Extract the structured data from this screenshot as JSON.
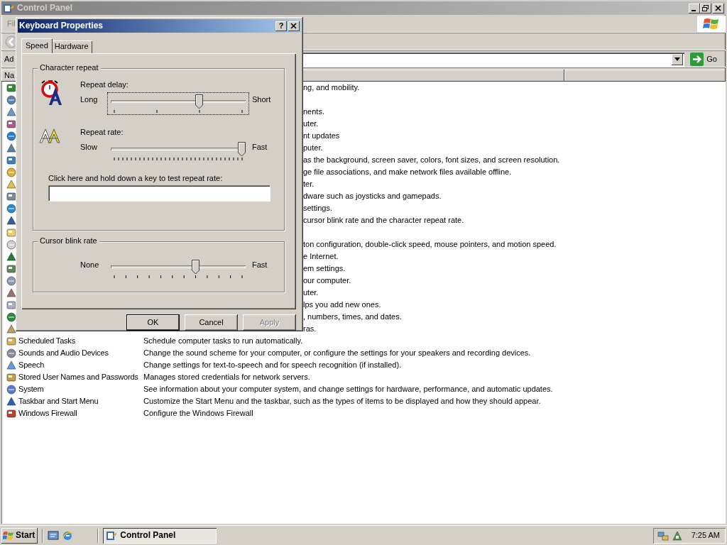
{
  "window": {
    "title": "Control Panel",
    "menu_item": "Fil",
    "address_label": "Ad",
    "go_button": "Go",
    "column_header": "Na"
  },
  "list": {
    "rows": [
      {
        "description": "ng, and mobility."
      },
      {},
      {
        "description": "nents."
      },
      {
        "description": "uter."
      },
      {
        "description": "nt updates"
      },
      {
        "description": "puter."
      },
      {
        "description": "as the background, screen saver, colors, font sizes, and screen resolution."
      },
      {
        "description": "ge file associations, and make network files available offline."
      },
      {
        "description": "ter."
      },
      {
        "description": "dware such as joysticks and gamepads."
      },
      {
        "description": "settings."
      },
      {
        "description": "cursor blink rate and the character repeat rate."
      },
      {},
      {
        "description": "ton configuration, double-click speed, mouse pointers, and motion speed."
      },
      {
        "description": "e Internet."
      },
      {
        "description": "em settings."
      },
      {
        "description": "our computer."
      },
      {
        "description": "uter."
      },
      {
        "description": "lps you add new ones."
      },
      {
        "description": ", numbers, times, and dates."
      },
      {
        "description": "ras."
      },
      {
        "name": "Scheduled Tasks",
        "description": "Schedule computer tasks to run automatically."
      },
      {
        "name": "Sounds and Audio Devices",
        "description": "Change the sound scheme for your computer, or configure the settings for your speakers and recording devices."
      },
      {
        "name": "Speech",
        "description": "Change settings for text-to-speech and for speech recognition (if installed)."
      },
      {
        "name": "Stored User Names and Passwords",
        "description": "Manages stored credentials for network servers."
      },
      {
        "name": "System",
        "description": "See information about your computer system, and change settings for hardware, performance, and automatic updates."
      },
      {
        "name": "Taskbar and Start Menu",
        "description": "Customize the Start Menu and the taskbar, such as the types of items to be displayed and how they should appear."
      },
      {
        "name": "Windows Firewall",
        "description": "Configure the Windows Firewall"
      }
    ]
  },
  "dialog": {
    "title": "Keyboard Properties",
    "help_button": "?",
    "tabs": [
      {
        "label": "Speed",
        "selected": true
      },
      {
        "label": "Hardware",
        "selected": false
      }
    ],
    "character_repeat": {
      "title": "Character repeat",
      "repeat_delay": {
        "label": "Repeat delay:",
        "low": "Long",
        "high": "Short",
        "level": 0.667,
        "focused": true
      },
      "repeat_rate": {
        "label": "Repeat rate:",
        "low": "Slow",
        "high": "Fast",
        "level": 1,
        "focused": false
      },
      "test_label": "Click here and hold down a key to test repeat rate:"
    },
    "cursor_blink": {
      "title": "Cursor blink rate",
      "low": "None",
      "high": "Fast",
      "level": 0.636,
      "focused": false
    },
    "buttons": [
      {
        "label": "OK",
        "default": true,
        "disabled": false
      },
      {
        "label": "Cancel",
        "default": false,
        "disabled": false
      },
      {
        "label": "Apply",
        "default": false,
        "disabled": true
      }
    ]
  },
  "taskbar": {
    "start": "Start",
    "tasks": [
      {
        "label": "Control Panel",
        "selected": true
      }
    ],
    "clock": "7:25 AM"
  }
}
